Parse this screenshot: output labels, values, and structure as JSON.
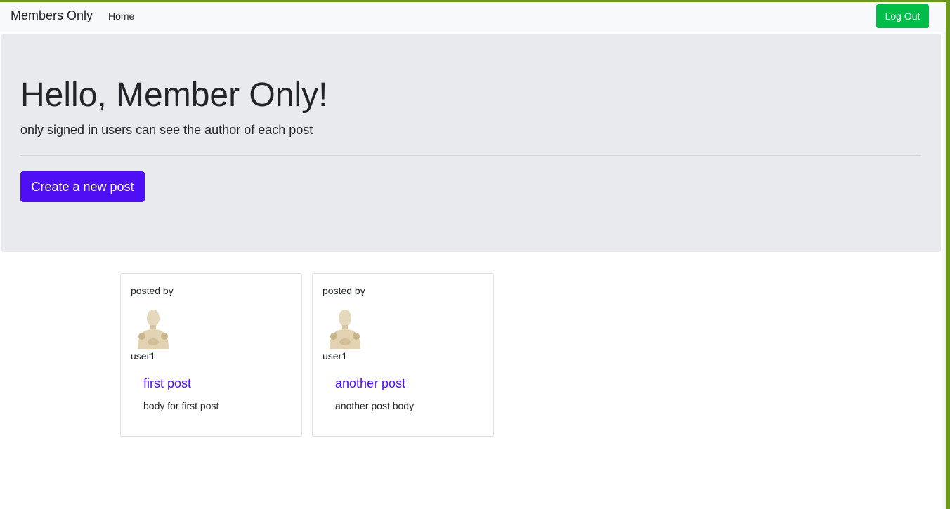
{
  "navbar": {
    "brand": "Members Only",
    "links": [
      {
        "label": "Home"
      }
    ],
    "logout_label": "Log Out"
  },
  "hero": {
    "title": "Hello, Member Only!",
    "subtitle": "only signed in users can see the author of each post",
    "create_button": "Create a new post"
  },
  "posts": [
    {
      "posted_by_label": "posted by",
      "author": "user1",
      "title": "first post",
      "body": "body for first post"
    },
    {
      "posted_by_label": "posted by",
      "author": "user1",
      "title": "another post",
      "body": "another post body"
    }
  ],
  "colors": {
    "accent": "#4e0ff5",
    "logout": "#00bd4a",
    "window_border": "#6b9a1f",
    "jumbotron": "#e9eaee",
    "navbar": "#f8f9fa"
  },
  "icons": {
    "avatar": "wooden-mannequin-avatar"
  }
}
